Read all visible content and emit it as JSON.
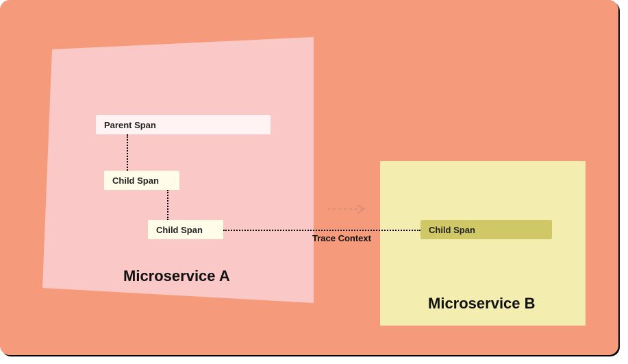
{
  "colors": {
    "canvas": "#f59b7b",
    "serviceA": "#fac9c7",
    "serviceB": "#f3eeb0",
    "parentSpan": "#fff3f3",
    "childSpanA": "#fffde9",
    "childSpanB": "#d0c867",
    "arrow": "#df8e78"
  },
  "spans": {
    "parent": "Parent Span",
    "childA1": "Child Span",
    "childA2": "Child Span",
    "childB": "Child Span"
  },
  "labels": {
    "serviceA": "Microservice A",
    "serviceB": "Microservice B",
    "trace": "Trace Context"
  }
}
